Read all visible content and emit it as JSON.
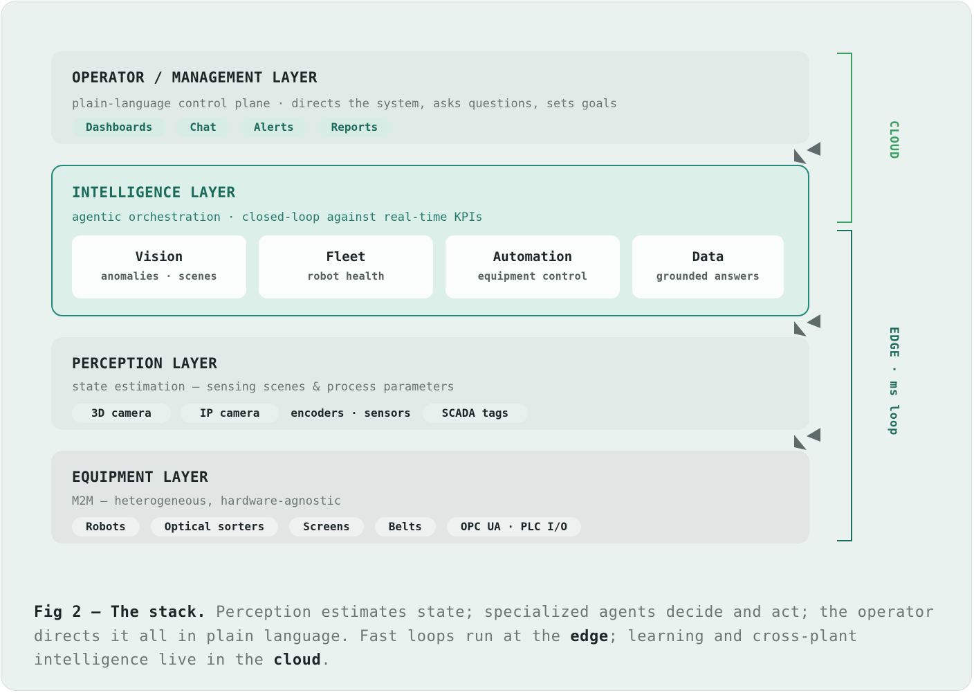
{
  "layers": {
    "operator": {
      "title": "OPERATOR / MANAGEMENT LAYER",
      "desc": "plain-language control plane · directs the system, asks questions, sets goals",
      "chips": [
        "Dashboards",
        "Chat",
        "Alerts",
        "Reports"
      ]
    },
    "intelligence": {
      "title": "INTELLIGENCE LAYER",
      "desc": "agentic orchestration · closed-loop against real-time KPIs",
      "agents": [
        {
          "name": "Vision",
          "sub": "anomalies · scenes"
        },
        {
          "name": "Fleet",
          "sub": "robot health"
        },
        {
          "name": "Automation",
          "sub": "equipment control"
        },
        {
          "name": "Data",
          "sub": "grounded answers"
        }
      ]
    },
    "perception": {
      "title": "PERCEPTION LAYER",
      "desc": "state estimation — sensing scenes & process parameters",
      "chips": [
        "3D camera",
        "IP camera",
        "encoders · sensors",
        "SCADA tags"
      ]
    },
    "equipment": {
      "title": "EQUIPMENT LAYER",
      "desc": "M2M — heterogeneous, hardware-agnostic",
      "chips": [
        "Robots",
        "Optical sorters",
        "Screens",
        "Belts",
        "OPC UA · PLC I/O"
      ]
    }
  },
  "brackets": {
    "cloud": "CLOUD",
    "edge": "EDGE · ms loop"
  },
  "caption": {
    "lead": "Fig 2 — The stack.",
    "part1": " Perception estimates state; specialized agents decide and act; the operator directs it all in plain language. Fast loops run at the ",
    "edge": "edge",
    "part2": "; learning and cross-plant intelligence live in the ",
    "cloud": "cloud",
    "part3": "."
  },
  "colors": {
    "intelligence_border": "#23897a",
    "cloud_accent": "#3aa060",
    "edge_accent": "#1f6e5d",
    "arrow": "#5f6b68"
  }
}
